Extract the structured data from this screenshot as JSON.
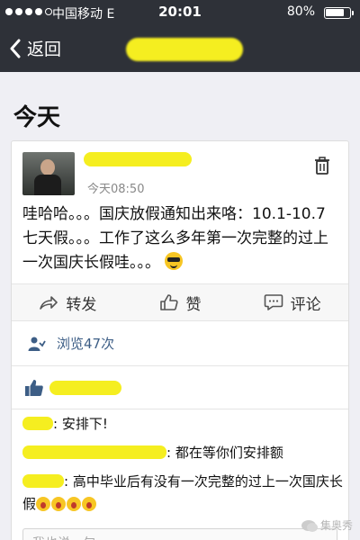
{
  "status_bar": {
    "carrier": "中国移动  E",
    "time": "20:01",
    "battery": "80%"
  },
  "nav": {
    "back_label": "返回",
    "title": ""
  },
  "section_title": "今天",
  "post": {
    "author": "",
    "time": "今天08:50",
    "text": "哇哈哈。。。国庆放假通知出来咯：10.1-10.7七天假。。。工作了这么多年第一次完整的过上一次国庆长假哇。。。",
    "emoji_icon": "cool-emoji-icon"
  },
  "actions": {
    "share_label": "转发",
    "like_label": "赞",
    "comment_label": "评论"
  },
  "views": {
    "label": "浏览47次"
  },
  "comments": [
    {
      "author": "",
      "text": ": 安排下!"
    },
    {
      "author": "",
      "text": ": 都在等你们安排额"
    },
    {
      "author": "",
      "text": ": 高中毕业后有没有一次完整的过上一次国庆长假"
    }
  ],
  "reply": {
    "placeholder": "我也说一句"
  },
  "watermark": {
    "text": "集奥秀"
  },
  "colors": {
    "header_bg": "#2e3138",
    "link_blue": "#3d5e86",
    "redaction_yellow": "#f5ee20"
  }
}
